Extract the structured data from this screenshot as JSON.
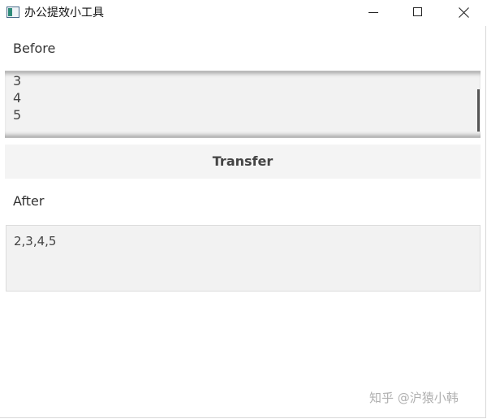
{
  "window": {
    "title": "办公提效小工具",
    "icon": "app-window-icon",
    "controls": {
      "minimize": "minimize-icon",
      "maximize": "maximize-icon",
      "close": "close-icon"
    }
  },
  "before": {
    "label": "Before",
    "visible_lines": [
      "3",
      "4",
      "5"
    ]
  },
  "transfer": {
    "label": "Transfer"
  },
  "after": {
    "label": "After",
    "value": "2,3,4,5"
  },
  "watermark": "知乎 @沪猿小韩"
}
